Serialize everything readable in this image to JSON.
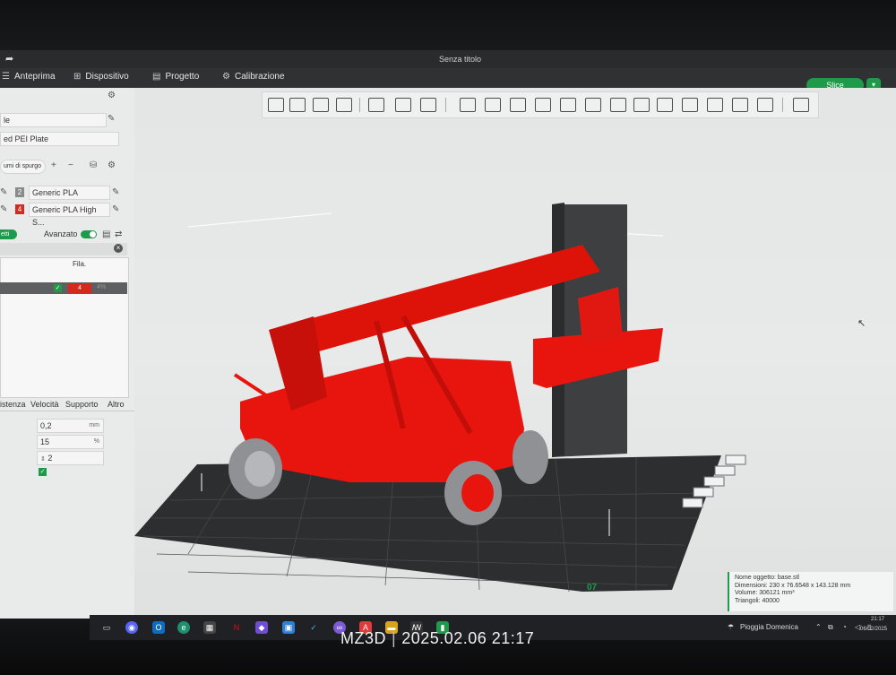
{
  "window": {
    "title": "Senza titolo"
  },
  "menubar": {
    "items": [
      {
        "label": "Anteprima",
        "icon": "layers-icon"
      },
      {
        "label": "Dispositivo",
        "icon": "device-icon"
      },
      {
        "label": "Progetto",
        "icon": "project-icon"
      },
      {
        "label": "Calibrazione",
        "icon": "calibration-icon"
      }
    ],
    "slice_label": "Slice"
  },
  "left_panel": {
    "printer_field": "le",
    "plate_field": "ed PEI Plate",
    "purge_button": "umi di spurgo",
    "filaments": [
      {
        "index": "2",
        "name": "Generic PLA",
        "color": "#8a8a8a"
      },
      {
        "index": "4",
        "name": "Generic PLA High S...",
        "color": "#d42a1e"
      }
    ],
    "objects_pill": "etti",
    "advanced_label": "Avanzato",
    "list_header": "Fila.",
    "row_filament": "4",
    "row_extra": "4%",
    "tabs": [
      "istenza",
      "Velocità",
      "Supporto",
      "Altro"
    ],
    "settings": [
      {
        "value": "0,2",
        "unit": "mm"
      },
      {
        "value": "15",
        "unit": "%"
      },
      {
        "value": "2",
        "unit": ""
      }
    ]
  },
  "viewport": {
    "plate_label": "07",
    "model_color": "#e8150f",
    "tower_color": "#3e3f40"
  },
  "object_info": {
    "name": "Nome oggetto: base.stl",
    "dimensions": "Dimensioni: 230 x 76.6548 x 143.128 mm",
    "volume": "Volume: 306121 mm³",
    "triangles": "Triangoli: 40000"
  },
  "taskbar": {
    "weather": "Pioggia Domenica",
    "time": "21:17",
    "date": "06/02/2025"
  },
  "watermark": {
    "brand": "MZ3D",
    "datetime": "2025.02.06 21:17"
  }
}
